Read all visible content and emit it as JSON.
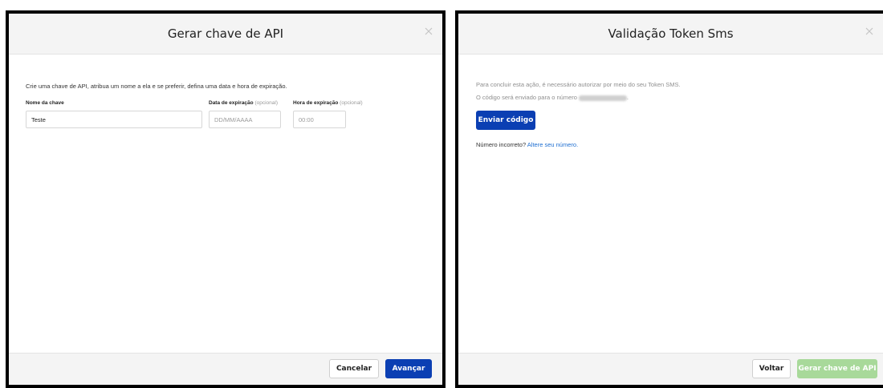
{
  "left_modal": {
    "title": "Gerar chave de API",
    "close_icon": "close-icon",
    "description": "Crie uma chave de API, atribua um nome a ela e se preferir, defina uma data e hora de expiração.",
    "fields": {
      "key_name_label": "Nome da chave",
      "key_name_value": "Teste",
      "expiration_date_label": "Data de expiração",
      "expiration_date_optional": "(opcional)",
      "expiration_date_placeholder": "DD/MM/AAAA",
      "expiration_time_label": "Hora de expiração",
      "expiration_time_optional": "(opcional)",
      "expiration_time_placeholder": "00:00"
    },
    "footer": {
      "cancel_label": "Cancelar",
      "next_label": "Avançar"
    }
  },
  "right_modal": {
    "title": "Validação Token Sms",
    "close_icon": "close-icon",
    "line1": "Para concluir esta ação, é necessário autorizar por meio do seu Token SMS.",
    "line2_prefix": "O código será enviado para o número",
    "line2_suffix": ".",
    "send_code_label": "Enviar código",
    "wrong_number_text": "Número incorreto?",
    "change_number_link": "Altere seu número.",
    "footer": {
      "back_label": "Voltar",
      "generate_label": "Gerar chave de API"
    }
  },
  "colors": {
    "primary": "#0b3fb3",
    "disabled_green": "#a8d99a",
    "link": "#1f6fd1",
    "header_bg": "#f4f4f4"
  }
}
